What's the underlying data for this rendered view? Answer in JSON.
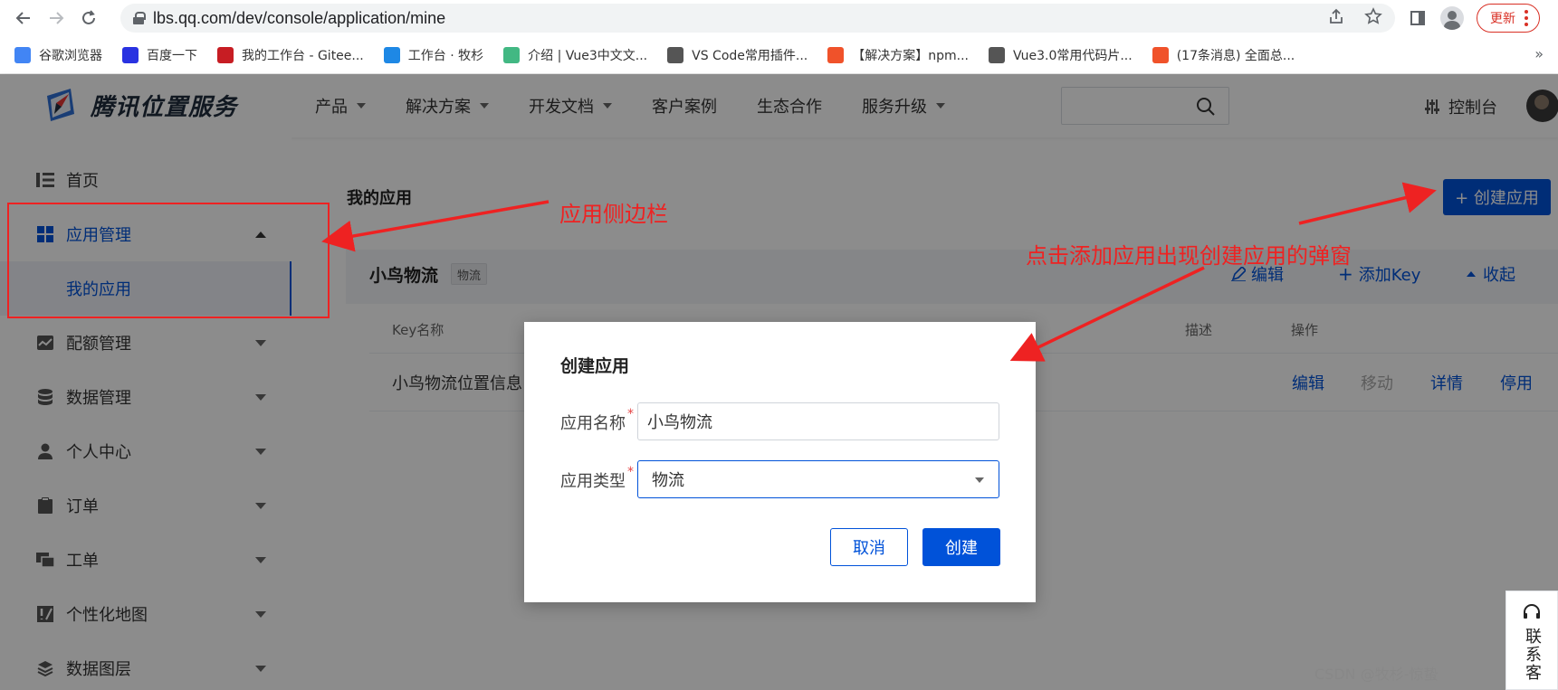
{
  "browser": {
    "url": "lbs.qq.com/dev/console/application/mine",
    "update_label": "更新",
    "bookmarks": [
      {
        "label": "谷歌浏览器",
        "color": "#4285f4"
      },
      {
        "label": "百度一下",
        "color": "#2932e1"
      },
      {
        "label": "我的工作台 - Gitee...",
        "color": "#c71d23"
      },
      {
        "label": "工作台 · 牧杉",
        "color": "#1e88e5"
      },
      {
        "label": "介绍 | Vue3中文文...",
        "color": "#42b883"
      },
      {
        "label": "VS Code常用插件...",
        "color": "#555555"
      },
      {
        "label": "【解决方案】npm...",
        "color": "#f0522a"
      },
      {
        "label": "Vue3.0常用代码片...",
        "color": "#555555"
      },
      {
        "label": "(17条消息) 全面总...",
        "color": "#f0522a"
      }
    ],
    "more": "»"
  },
  "header": {
    "brand": "腾讯位置服务",
    "nav": [
      {
        "label": "产品",
        "dropdown": true
      },
      {
        "label": "解决方案",
        "dropdown": true
      },
      {
        "label": "开发文档",
        "dropdown": true
      },
      {
        "label": "客户案例",
        "dropdown": false
      },
      {
        "label": "生态合作",
        "dropdown": false
      },
      {
        "label": "服务升级",
        "dropdown": true
      }
    ],
    "console": "控制台"
  },
  "sidebar": {
    "items": [
      {
        "label": "首页",
        "icon": "list-icon"
      },
      {
        "label": "应用管理",
        "icon": "grid-icon",
        "expanded": true
      },
      {
        "label": "我的应用",
        "sub": true
      },
      {
        "label": "配额管理",
        "icon": "chart-icon"
      },
      {
        "label": "数据管理",
        "icon": "database-icon"
      },
      {
        "label": "个人中心",
        "icon": "user-icon"
      },
      {
        "label": "订单",
        "icon": "clipboard-icon"
      },
      {
        "label": "工单",
        "icon": "ticket-icon"
      },
      {
        "label": "个性化地图",
        "icon": "map-style-icon"
      },
      {
        "label": "数据图层",
        "icon": "layers-icon"
      }
    ]
  },
  "main": {
    "title": "我的应用",
    "create_button": "+ 创建应用",
    "app": {
      "name": "小鸟物流",
      "tag": "物流",
      "actions": {
        "edit": "编辑",
        "add_key": "添加Key",
        "collapse": "收起"
      }
    },
    "table": {
      "headers": {
        "key_name": "Key名称",
        "desc": "描述",
        "ops": "操作"
      },
      "row": {
        "key_name": "小鸟物流位置信息",
        "links": {
          "edit": "编辑",
          "move": "移动",
          "detail": "详情",
          "disable": "停用"
        }
      }
    }
  },
  "modal": {
    "title": "创建应用",
    "name_label": "应用名称",
    "name_value": "小鸟物流",
    "type_label": "应用类型",
    "type_value": "物流",
    "cancel": "取消",
    "create": "创建"
  },
  "annotations": {
    "sidebar_note": "应用侧边栏",
    "popup_note": "点击添加应用出现创建应用的弹窗",
    "color": "#ee2222"
  },
  "contact": "联系客",
  "watermark": "CSDN @牧杉-惊蛰"
}
